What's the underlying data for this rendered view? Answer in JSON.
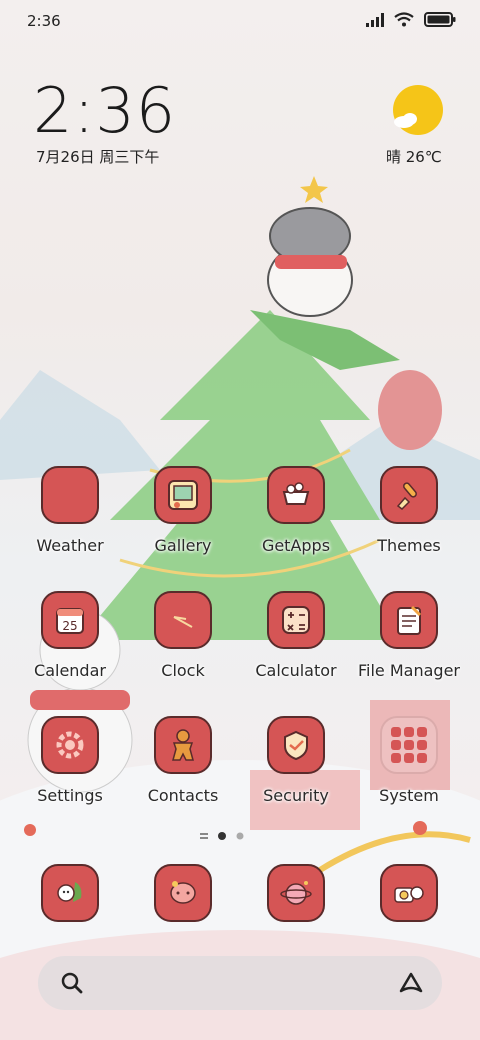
{
  "status_bar": {
    "time": "2:36"
  },
  "clock_widget": {
    "time": "2:36",
    "date": "7月26日 周三下午"
  },
  "weather_widget": {
    "text": "晴 26℃",
    "icon": "sunny-cloud-icon"
  },
  "apps": [
    {
      "label": "Weather",
      "icon": "weather-app-icon"
    },
    {
      "label": "Gallery",
      "icon": "gallery-icon"
    },
    {
      "label": "GetApps",
      "icon": "getapps-icon"
    },
    {
      "label": "Themes",
      "icon": "themes-brush-icon"
    },
    {
      "label": "Calendar",
      "icon": "calendar-icon",
      "day": "25"
    },
    {
      "label": "Clock",
      "icon": "clock-icon"
    },
    {
      "label": "Calculator",
      "icon": "calculator-icon"
    },
    {
      "label": "File Manager",
      "icon": "file-manager-icon"
    },
    {
      "label": "Settings",
      "icon": "settings-gear-icon"
    },
    {
      "label": "Contacts",
      "icon": "gingerbread-contacts-icon"
    },
    {
      "label": "Security",
      "icon": "security-shield-icon"
    },
    {
      "label": "System",
      "icon": "folder-icon"
    }
  ],
  "dock": [
    {
      "icon": "phone-cat-icon"
    },
    {
      "icon": "messages-icon"
    },
    {
      "icon": "browser-planet-icon"
    },
    {
      "icon": "camera-cat-icon"
    }
  ],
  "pager": {
    "pages": 3,
    "current": 2
  },
  "colors": {
    "tile": "#d55555",
    "tile_border": "#5a2b2b",
    "sun": "#f5c518"
  }
}
